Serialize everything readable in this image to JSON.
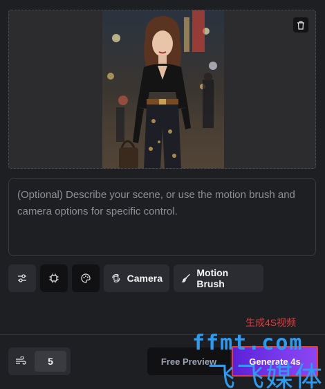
{
  "prompt": {
    "placeholder": "(Optional) Describe your scene, or use the motion brush and camera options for specific control."
  },
  "toolbar": {
    "camera_label": "Camera",
    "motion_brush_label": "Motion Brush"
  },
  "footer": {
    "motion_value": "5",
    "free_preview_label": "Free Preview",
    "generate_label": "Generate 4s"
  },
  "annotation": {
    "chinese_label": "生成4S视频"
  },
  "watermark": {
    "top": "ffmt.com",
    "bottom": "飞飞媒体"
  },
  "colors": {
    "accent": "#7c3aed",
    "annotation_red": "#e23c3c",
    "watermark_blue": "#2f9bf0"
  }
}
